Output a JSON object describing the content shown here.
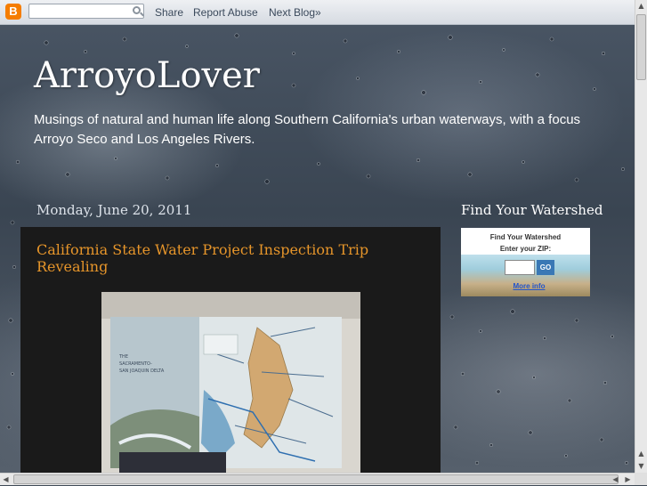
{
  "navbar": {
    "search_placeholder": "",
    "share_label": "Share",
    "report_label": "Report Abuse",
    "next_label": "Next Blog»"
  },
  "header": {
    "title": "ArroyoLover",
    "description_line1": "Musings of natural and human life along Southern California's urban waterways, with a focus",
    "description_line2": "Arroyo Seco and Los Angeles Rivers."
  },
  "post": {
    "date": "Monday, June 20, 2011",
    "title": "California State Water Project Inspection Trip Revealing",
    "image_caption_line1": "THE",
    "image_caption_line2": "SACRAMENTO-",
    "image_caption_line3": "SAN JOAQUIN DELTA"
  },
  "sidebar": {
    "widget_heading": "Find Your Watershed",
    "widget_title": "Find Your Watershed",
    "widget_zip_label": "Enter your ZIP:",
    "widget_go": "GO",
    "widget_more_info": "More info"
  },
  "colors": {
    "post_title": "#e6952a",
    "post_bg": "#1a1a1a",
    "blogger_orange": "#f57d00"
  }
}
